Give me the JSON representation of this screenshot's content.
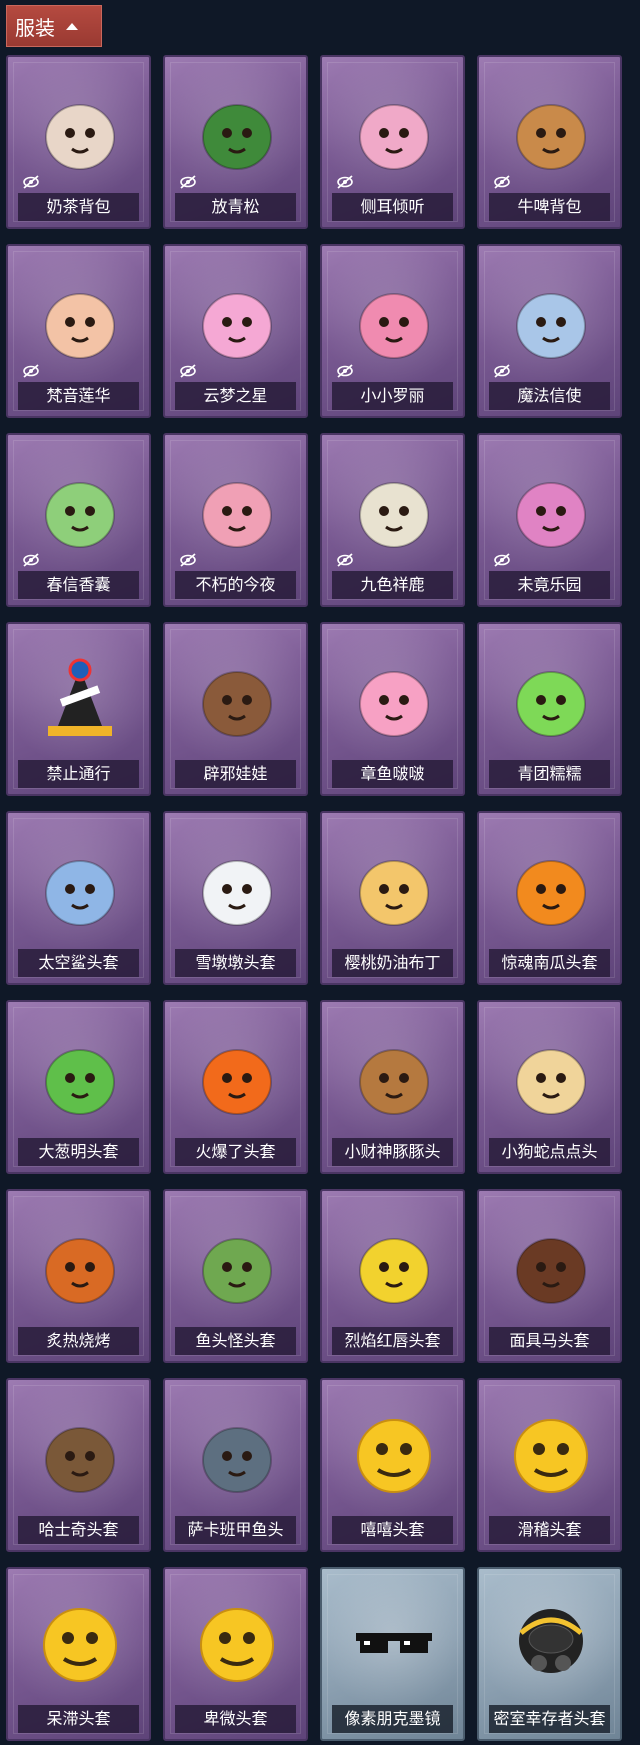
{
  "header": {
    "label": "服装"
  },
  "items": [
    {
      "label": "奶茶背包",
      "icon": "milk-tea-backpack",
      "hidden": true,
      "theme": "purple",
      "color": "#e8d6c8"
    },
    {
      "label": "放青松",
      "icon": "bonsai-pine",
      "hidden": true,
      "theme": "purple",
      "color": "#3f8a3a"
    },
    {
      "label": "侧耳倾听",
      "icon": "flower-wreath",
      "hidden": true,
      "theme": "purple",
      "color": "#f0a9c8"
    },
    {
      "label": "牛啤背包",
      "icon": "cow-barrel",
      "hidden": true,
      "theme": "purple",
      "color": "#c98a4a"
    },
    {
      "label": "梵音莲华",
      "icon": "lotus-girl",
      "hidden": true,
      "theme": "purple",
      "color": "#f3c3a6"
    },
    {
      "label": "云梦之星",
      "icon": "unicorn-cloud",
      "hidden": true,
      "theme": "purple",
      "color": "#f5a8d4"
    },
    {
      "label": "小小罗丽",
      "icon": "doll-girl",
      "hidden": true,
      "theme": "purple",
      "color": "#f08bb0"
    },
    {
      "label": "魔法信使",
      "icon": "elephant-plush",
      "hidden": true,
      "theme": "purple",
      "color": "#a9c6e8"
    },
    {
      "label": "春信香囊",
      "icon": "sachet",
      "hidden": true,
      "theme": "purple",
      "color": "#8ecf7a"
    },
    {
      "label": "不朽的今夜",
      "icon": "fox-cup",
      "hidden": true,
      "theme": "purple",
      "color": "#f0a0b5"
    },
    {
      "label": "九色祥鹿",
      "icon": "deer",
      "hidden": true,
      "theme": "purple",
      "color": "#e8e2d0"
    },
    {
      "label": "未竟乐园",
      "icon": "clown-girl",
      "hidden": true,
      "theme": "purple",
      "color": "#e083c4"
    },
    {
      "label": "禁止通行",
      "icon": "no-entry-cone",
      "hidden": false,
      "theme": "purple",
      "color": "#f0b429"
    },
    {
      "label": "辟邪娃娃",
      "icon": "doll-head",
      "hidden": false,
      "theme": "purple",
      "color": "#8a5a3a"
    },
    {
      "label": "章鱼啵啵",
      "icon": "octopus",
      "hidden": false,
      "theme": "purple",
      "color": "#f7a1c4"
    },
    {
      "label": "青团糯糯",
      "icon": "green-dumpling",
      "hidden": false,
      "theme": "purple",
      "color": "#7ed957"
    },
    {
      "label": "太空鲨头套",
      "icon": "shark-helmet",
      "hidden": false,
      "theme": "purple",
      "color": "#8fb6e6"
    },
    {
      "label": "雪墩墩头套",
      "icon": "snowman-head",
      "hidden": false,
      "theme": "purple",
      "color": "#f1f3f6"
    },
    {
      "label": "樱桃奶油布丁",
      "icon": "pudding",
      "hidden": false,
      "theme": "purple",
      "color": "#f3c66b"
    },
    {
      "label": "惊魂南瓜头套",
      "icon": "pumpkin",
      "hidden": false,
      "theme": "purple",
      "color": "#f28a1e"
    },
    {
      "label": "大葱明头套",
      "icon": "scallion",
      "hidden": false,
      "theme": "purple",
      "color": "#5fbf4a"
    },
    {
      "label": "火爆了头套",
      "icon": "fire-head",
      "hidden": false,
      "theme": "purple",
      "color": "#f26a1b"
    },
    {
      "label": "小财神豚豚头",
      "icon": "capybara",
      "hidden": false,
      "theme": "purple",
      "color": "#b5793f"
    },
    {
      "label": "小狗蛇点点头",
      "icon": "snake-head",
      "hidden": false,
      "theme": "purple",
      "color": "#f0d49a"
    },
    {
      "label": "炙热烧烤",
      "icon": "bbq-meat",
      "hidden": false,
      "theme": "purple",
      "color": "#d96a24"
    },
    {
      "label": "鱼头怪头套",
      "icon": "fish-mask",
      "hidden": false,
      "theme": "purple",
      "color": "#6fa850"
    },
    {
      "label": "烈焰红唇头套",
      "icon": "yellow-mouse",
      "hidden": false,
      "theme": "purple",
      "color": "#f2d22e"
    },
    {
      "label": "面具马头套",
      "icon": "horse-mask",
      "hidden": false,
      "theme": "purple",
      "color": "#6a3a24"
    },
    {
      "label": "哈士奇头套",
      "icon": "husky-sunglasses",
      "hidden": false,
      "theme": "purple",
      "color": "#7a5838"
    },
    {
      "label": "萨卡班甲鱼头",
      "icon": "fish-fossil",
      "hidden": false,
      "theme": "purple",
      "color": "#5d6f80"
    },
    {
      "label": "嘻嘻头套",
      "icon": "grin-emoji",
      "hidden": false,
      "theme": "purple",
      "color": "#f7c623"
    },
    {
      "label": "滑稽头套",
      "icon": "smirk-emoji",
      "hidden": false,
      "theme": "purple",
      "color": "#f7c623"
    },
    {
      "label": "呆滞头套",
      "icon": "blank-emoji",
      "hidden": false,
      "theme": "purple",
      "color": "#f7c623"
    },
    {
      "label": "卑微头套",
      "icon": "shy-emoji",
      "hidden": false,
      "theme": "purple",
      "color": "#f7c623"
    },
    {
      "label": "像素朋克墨镜",
      "icon": "pixel-sunglasses",
      "hidden": false,
      "theme": "light",
      "color": "#111111"
    },
    {
      "label": "密室幸存者头套",
      "icon": "gas-mask-helmet",
      "hidden": false,
      "theme": "light",
      "color": "#222222"
    }
  ]
}
